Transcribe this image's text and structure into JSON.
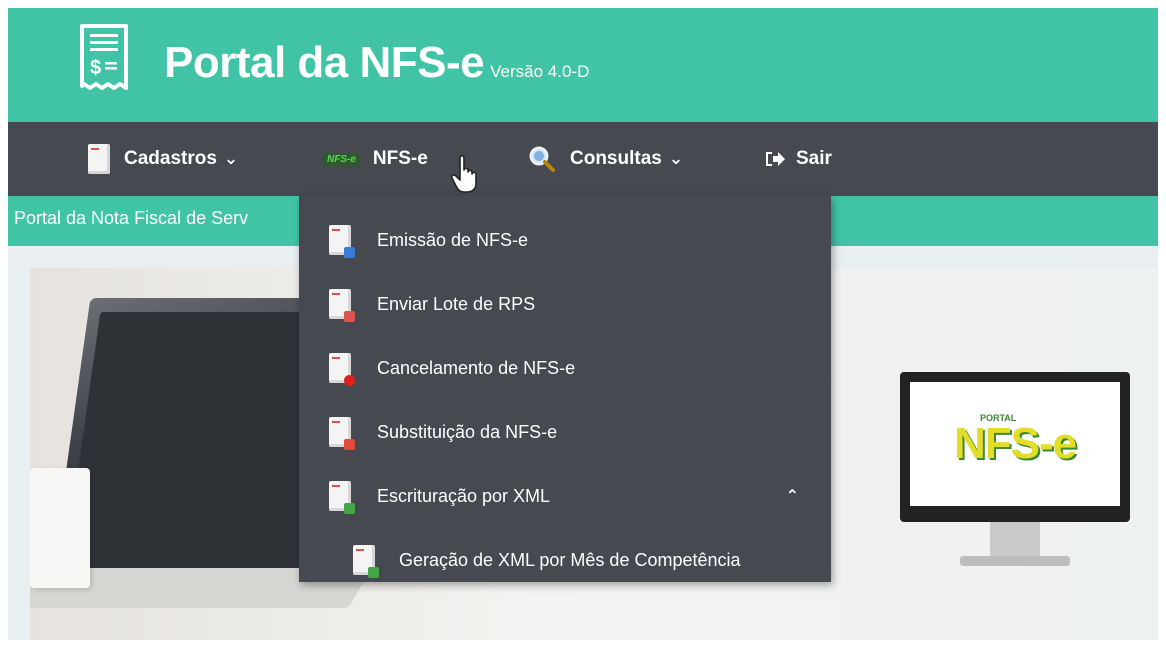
{
  "header": {
    "title": "Portal da NFS-e",
    "version": "Versão 4.0-D",
    "logo_icon": "receipt-dollar-icon"
  },
  "nav": {
    "items": [
      {
        "label": "Cadastros",
        "icon": "document-icon",
        "has_dropdown": true
      },
      {
        "label": "NFS-e",
        "icon": "nfse-badge-icon",
        "badge_text": "NFS-e",
        "has_dropdown": true
      },
      {
        "label": "Consultas",
        "icon": "magnifier-icon",
        "has_dropdown": true
      },
      {
        "label": "Sair",
        "icon": "sign-out-icon",
        "has_dropdown": false
      }
    ]
  },
  "strip": {
    "text": "Portal da Nota Fiscal de Serv"
  },
  "dropdown": {
    "items": [
      {
        "label": "Emissão de NFS-e",
        "icon": "document-print-icon"
      },
      {
        "label": "Enviar Lote de RPS",
        "icon": "document-rps-icon"
      },
      {
        "label": "Cancelamento de NFS-e",
        "icon": "document-cancel-icon"
      },
      {
        "label": "Substituição da NFS-e",
        "icon": "document-replace-icon"
      },
      {
        "label": "Escrituração por XML",
        "icon": "document-xml-icon",
        "expanded": true
      }
    ],
    "subitems": [
      {
        "label": "Geração de XML por Mês de Competência",
        "icon": "document-export-icon"
      }
    ]
  },
  "banner": {
    "logo_text": "NFS-e",
    "logo_small": "PORTAL"
  },
  "colors": {
    "header_green": "#41c4a6",
    "nav_dark": "#464950",
    "text_white": "#ffffff"
  }
}
